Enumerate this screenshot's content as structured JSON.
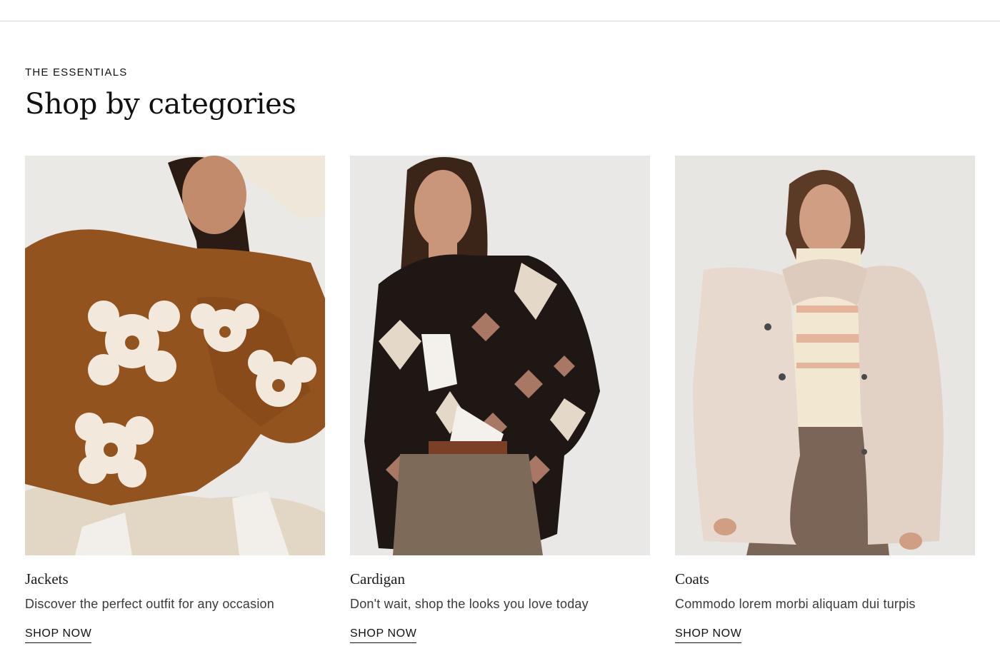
{
  "section": {
    "eyebrow": "THE ESSENTIALS",
    "title": "Shop by categories"
  },
  "categories": [
    {
      "title": "Jackets",
      "description": "Discover the perfect outfit for any occasion",
      "link_label": "SHOP NOW"
    },
    {
      "title": "Cardigan",
      "description": "Don't wait, shop the looks you love today",
      "link_label": "SHOP NOW"
    },
    {
      "title": "Coats",
      "description": "Commodo lorem morbi aliquam dui turpis",
      "link_label": "SHOP NOW"
    }
  ],
  "colors": {
    "background": "#ffffff",
    "text": "#111111",
    "photo_backdrop": "#ecebe8"
  }
}
